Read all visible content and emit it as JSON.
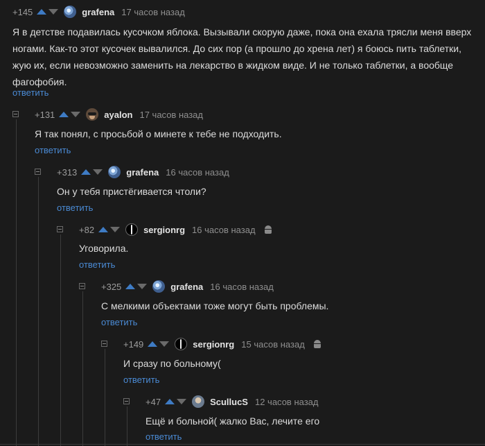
{
  "reply_label": "ответить",
  "colors": {
    "background": "#1b1b1b",
    "link": "#4a8ad4",
    "vote_up": "#3e7bc4",
    "vote_down": "#6a6a6a"
  },
  "comments": [
    {
      "score": "+145",
      "author": "grafena",
      "time": "17 часов назад",
      "avatar": "avatar-grafena-icon",
      "android": false,
      "text": "Я в детстве подавилась кусочком яблока. Вызывали скорую даже, пока она ехала трясли меня вверх ногами. Как-то этот кусочек вывалился. До сих пор (а прошло до хрена лет) я боюсь пить таблетки, жую их, если невозможно заменить на лекарство в жидком виде. И не только таблетки, а вообще фагофобия."
    },
    {
      "score": "+131",
      "author": "ayalon",
      "time": "17 часов назад",
      "avatar": "avatar-ayalon-icon",
      "android": false,
      "text": "Я так понял, с просьбой о минете к тебе не подходить."
    },
    {
      "score": "+313",
      "author": "grafena",
      "time": "16 часов назад",
      "avatar": "avatar-grafena-icon",
      "android": false,
      "text": "Он у тебя пристёгивается чтоли?"
    },
    {
      "score": "+82",
      "author": "sergionrg",
      "time": "16 часов назад",
      "avatar": "avatar-sergionrg-icon",
      "android": true,
      "text": "Уговорила."
    },
    {
      "score": "+325",
      "author": "grafena",
      "time": "16 часов назад",
      "avatar": "avatar-grafena-icon",
      "android": false,
      "text": "С мелкими объектами тоже могут быть проблемы."
    },
    {
      "score": "+149",
      "author": "sergionrg",
      "time": "15 часов назад",
      "avatar": "avatar-sergionrg-icon",
      "android": true,
      "text": "И сразу по больному("
    },
    {
      "score": "+47",
      "author": "ScullucS",
      "time": "12 часов назад",
      "avatar": "avatar-scullucs-icon",
      "android": false,
      "text": "Ещё и больной( жалко Вас, лечите его"
    }
  ]
}
